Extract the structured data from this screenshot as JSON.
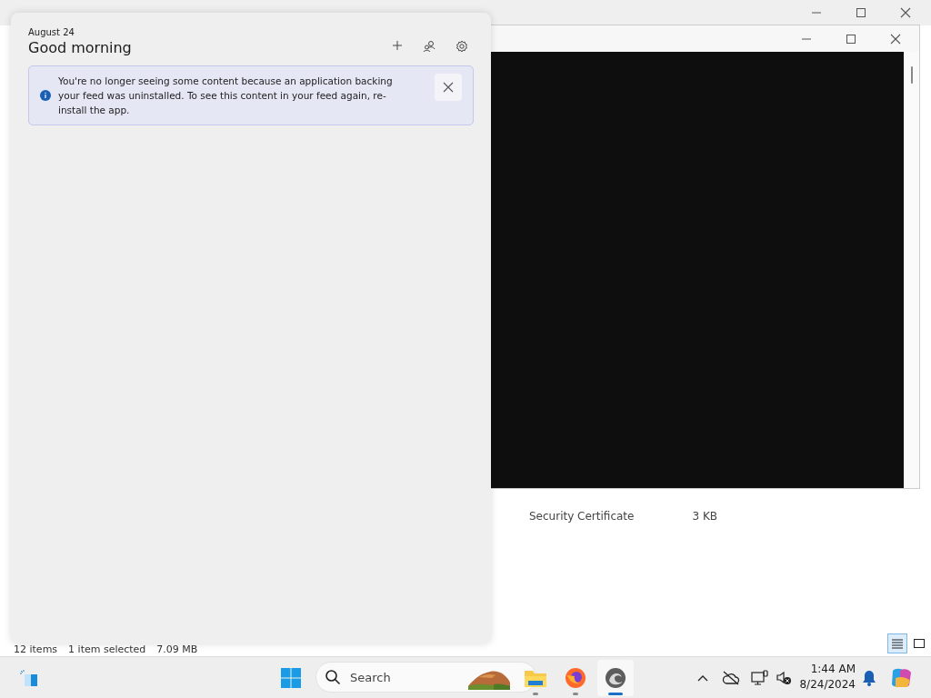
{
  "explorer": {
    "file_row": {
      "type": "Security Certificate",
      "size": "3 KB"
    },
    "status_bar": [
      "12 items",
      "1 item selected",
      "7.09 MB"
    ],
    "view_buttons": [
      {
        "kind": "details",
        "selected": true
      },
      {
        "kind": "tiles",
        "selected": false
      }
    ]
  },
  "widgets_panel": {
    "date": "August 24",
    "greeting": "Good morning",
    "notice": "You're no longer seeing some content because an application backing your feed was uninstalled. To see this content in your feed again, re-install the app."
  },
  "taskbar": {
    "search": {
      "placeholder": "Search"
    },
    "apps": [
      {
        "kind": "files",
        "selected": false
      },
      {
        "kind": "firefox",
        "selected": false
      },
      {
        "kind": "edge",
        "selected": true
      }
    ],
    "clock": {
      "time": "1:44 AM",
      "date": "8/24/2024"
    }
  }
}
